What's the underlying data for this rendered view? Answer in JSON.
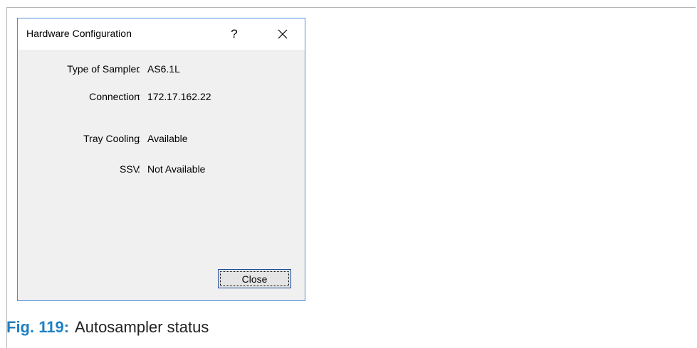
{
  "dialog": {
    "title": "Hardware Configuration",
    "help_label": "?",
    "close_icon": "close-icon",
    "rows": [
      {
        "label": "Type of Sampler",
        "value": "AS6.1L"
      },
      {
        "label": "Connection",
        "value": "172.17.162.22"
      },
      {
        "label": "Tray Cooling",
        "value": "Available"
      },
      {
        "label": "SSV",
        "value": "Not Available"
      }
    ],
    "close_button_label": "Close"
  },
  "caption": {
    "figure": "Fig. 119:",
    "text": "Autosampler status"
  },
  "colors": {
    "dialog_border": "#4a8fd8",
    "dialog_body": "#f0f0f0",
    "caption_accent": "#1f7fc4"
  }
}
